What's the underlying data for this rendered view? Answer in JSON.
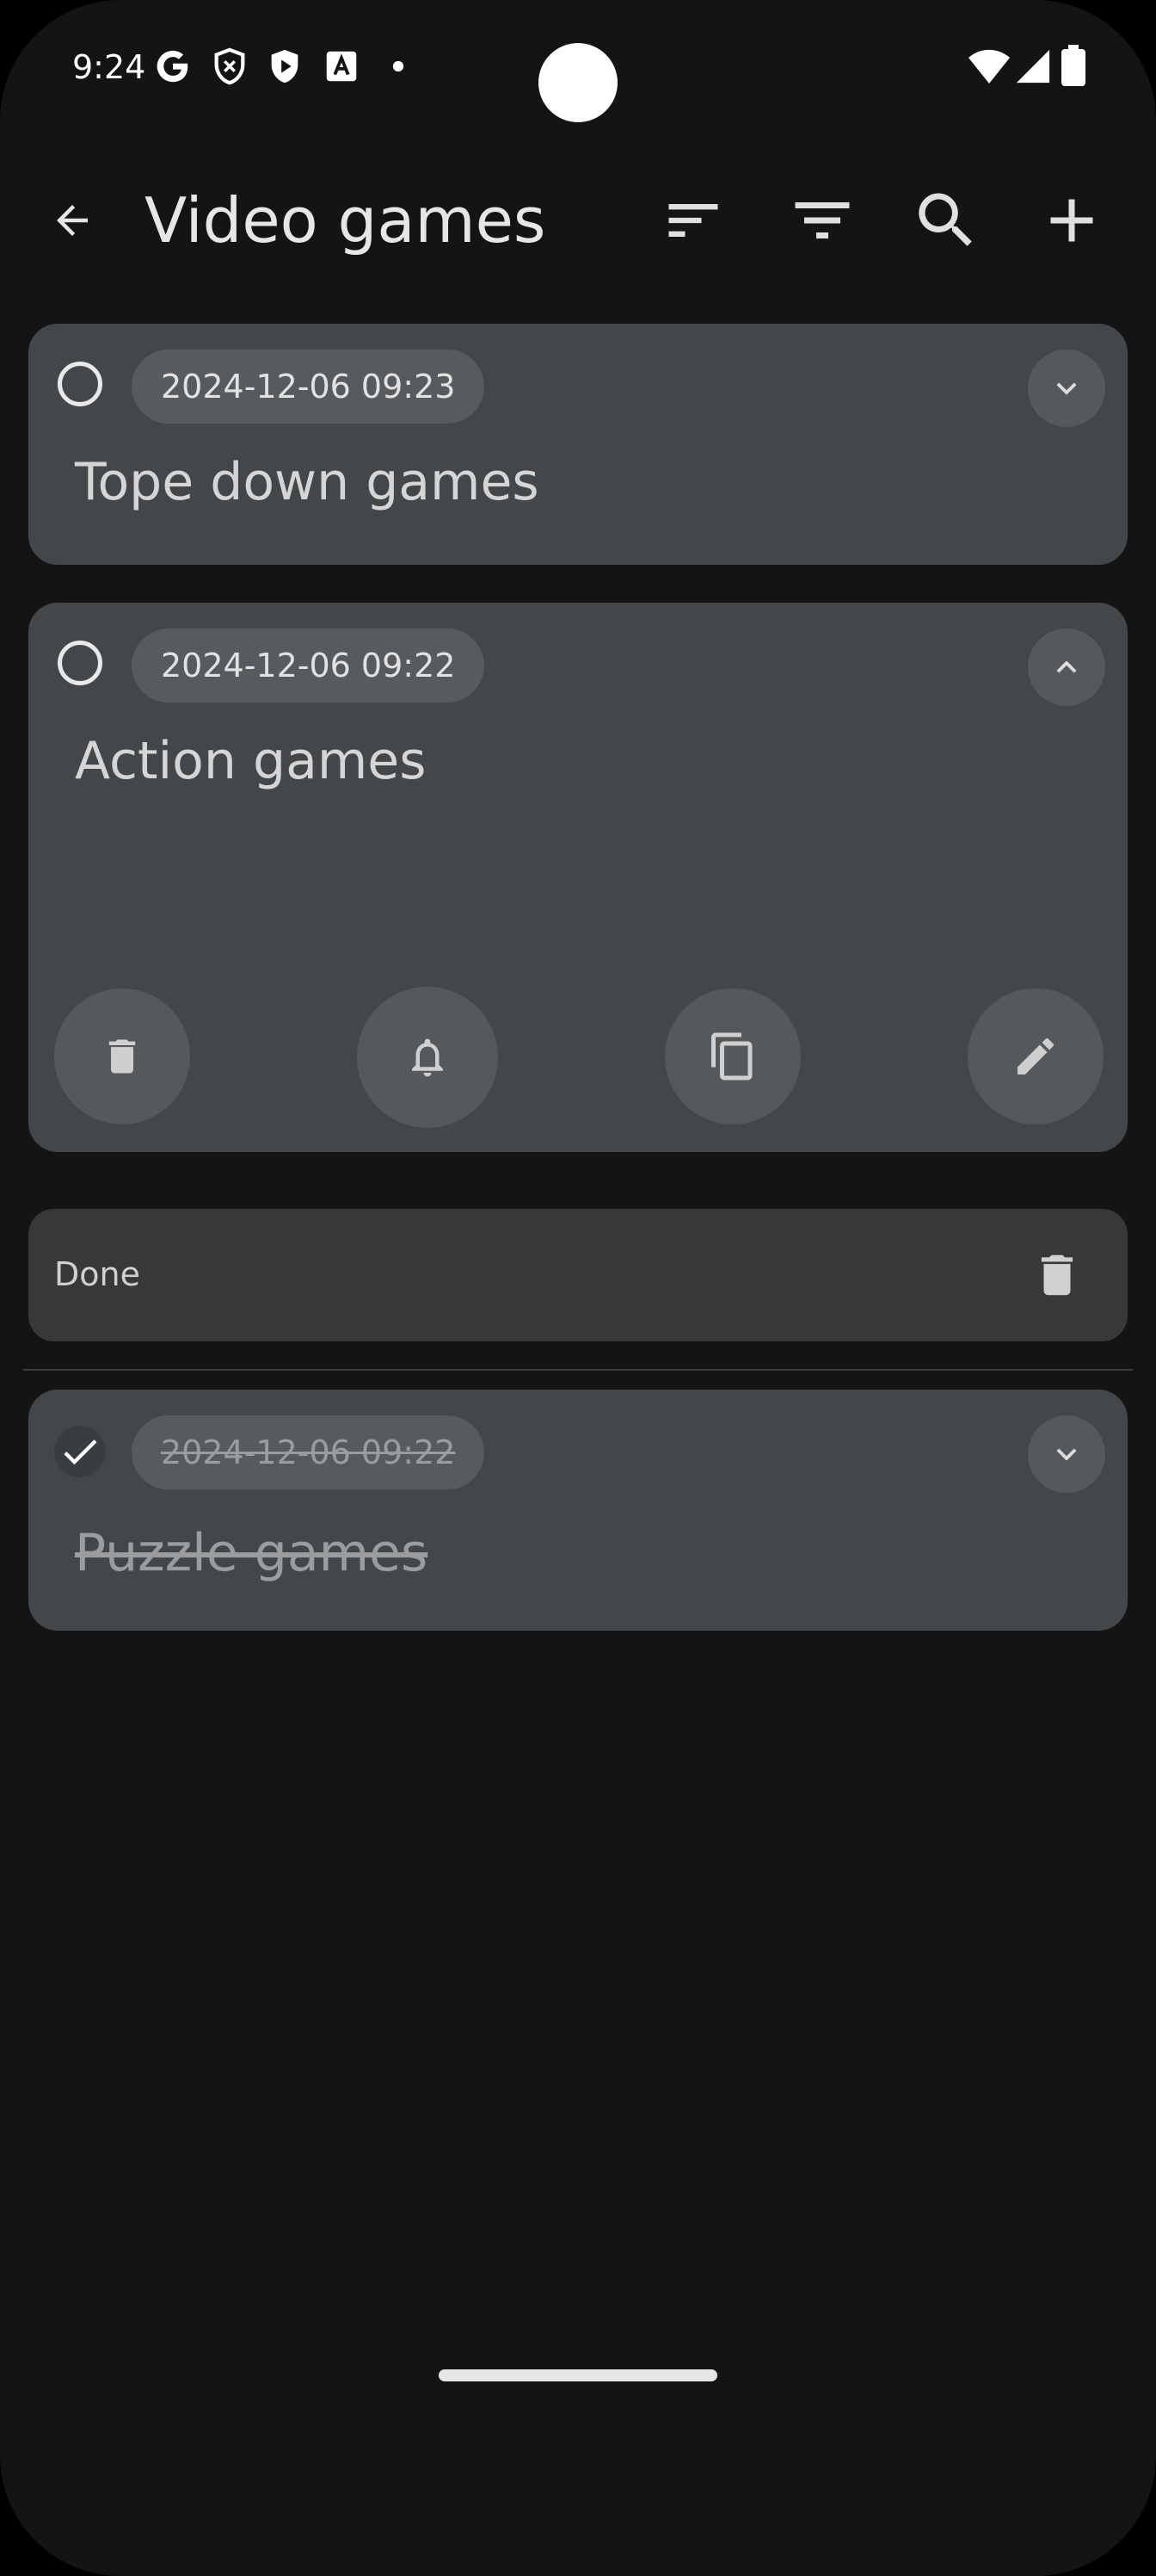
{
  "status_bar": {
    "time": "9:24",
    "left_icons": [
      "google-icon",
      "shield-icon",
      "play-shield-icon",
      "translate-icon",
      "dot-icon"
    ],
    "right_icons": [
      "wifi-icon",
      "signal-icon",
      "battery-icon"
    ]
  },
  "toolbar": {
    "title": "Video games",
    "actions": [
      "back-arrow-icon",
      "sort-icon",
      "filter-icon",
      "search-icon",
      "add-icon"
    ]
  },
  "tasks": [
    {
      "date": "2024-12-06 09:23",
      "title": "Tope down games",
      "expanded": false,
      "done": false
    },
    {
      "date": "2024-12-06 09:22",
      "title": "Action games",
      "expanded": true,
      "done": false,
      "actions": [
        "delete-icon",
        "bell-icon",
        "copy-icon",
        "edit-icon"
      ]
    }
  ],
  "done_section": {
    "label": "Done",
    "tasks": [
      {
        "date": "2024-12-06 09:22",
        "title": "Puzzle games",
        "done": true
      }
    ]
  },
  "colors": {
    "background": "#141414",
    "card": "#434749",
    "pill": "#575b5d",
    "done_header": "#363839"
  }
}
